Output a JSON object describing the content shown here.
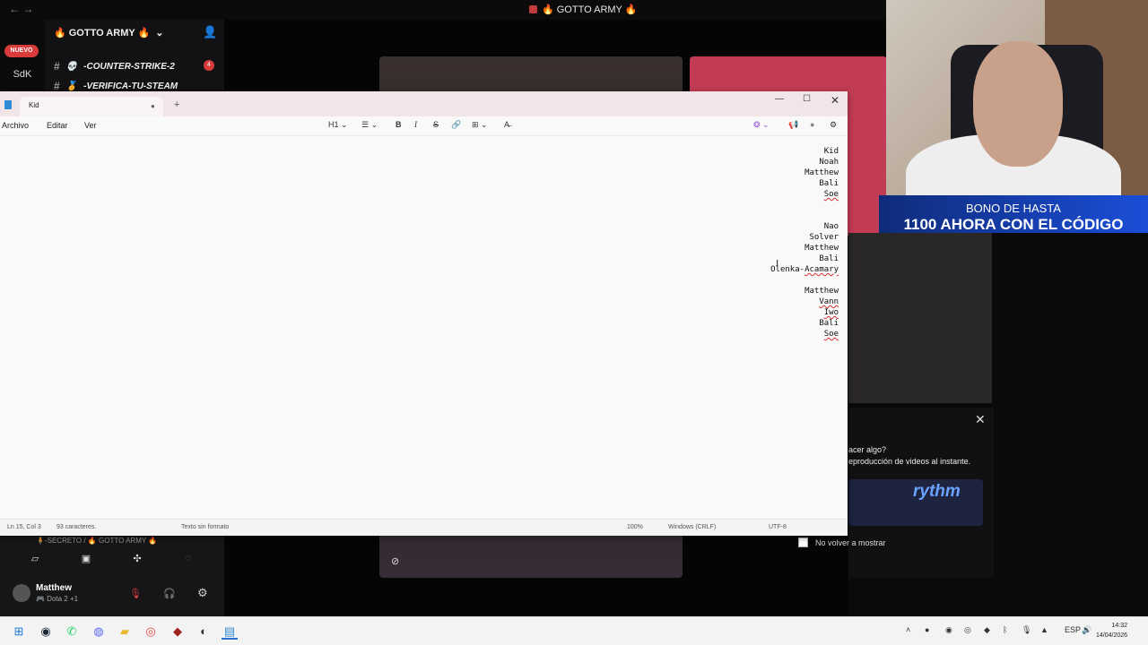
{
  "discord": {
    "window_title": "🔥 GOTTO ARMY 🔥",
    "nav_arrows": "← →",
    "nuevo_badge": "NUEVO",
    "sdk_label": "SdK",
    "server_name": "🔥 GOTTO ARMY 🔥",
    "channels": [
      {
        "emoji": "💀",
        "name": "-COUNTER-STRIKE-2",
        "badge": "4"
      },
      {
        "emoji": "🏅",
        "name": "-VERIFICA-TU-STEAM"
      }
    ],
    "voice_connected": "🧍-SECRETO / 🔥 GOTTO ARMY 🔥",
    "user": {
      "name": "Matthew",
      "status": "🎮 Dota 2 +1"
    }
  },
  "stream_overlay": {
    "promo_line1": "BONO DE HASTA",
    "promo_line2": "1100 AHORA CON EL CÓDIGO"
  },
  "popup": {
    "text1": "acer algo?",
    "text2": "eproducción de videos al instante.",
    "logo": "rythm",
    "checkbox_label": "No volver a mostrar"
  },
  "notepad": {
    "tab_title": "Kid",
    "menu": [
      "Archivo",
      "Editar",
      "Ver"
    ],
    "toolbar": {
      "heading": "H1",
      "list": "☰",
      "bold": "B",
      "italic": "I",
      "strike": "S",
      "link": "🔗",
      "table": "⊞",
      "format": "A̶"
    },
    "lines": [
      {
        "text": "Kid"
      },
      {
        "text": "Noah"
      },
      {
        "text": "Matthew"
      },
      {
        "text": "Bali"
      },
      {
        "text": "Soe",
        "squiggle": true
      },
      {
        "text": ""
      },
      {
        "text": ""
      },
      {
        "text": "Nao"
      },
      {
        "text": "Solver"
      },
      {
        "text": "Matthew"
      },
      {
        "text": "Bali"
      },
      {
        "text": "Olenka-Acamary",
        "squiggle_part": "Acamary"
      },
      {
        "text": ""
      },
      {
        "text": "Matthew"
      },
      {
        "text": "Vann",
        "squiggle": true
      },
      {
        "text": "Iwo",
        "squiggle": true
      },
      {
        "text": "Bali"
      },
      {
        "text": "Soe",
        "squiggle": true
      }
    ],
    "status": {
      "position": "Ln 15, Col 3",
      "chars": "93 caracteres.",
      "format": "Texto sin formato",
      "zoom": "100%",
      "line_endings": "Windows (CRLF)",
      "encoding": "UTF-8"
    }
  },
  "taskbar": {
    "language": "ESP",
    "time": "14:32",
    "date": "14/04/2026"
  }
}
